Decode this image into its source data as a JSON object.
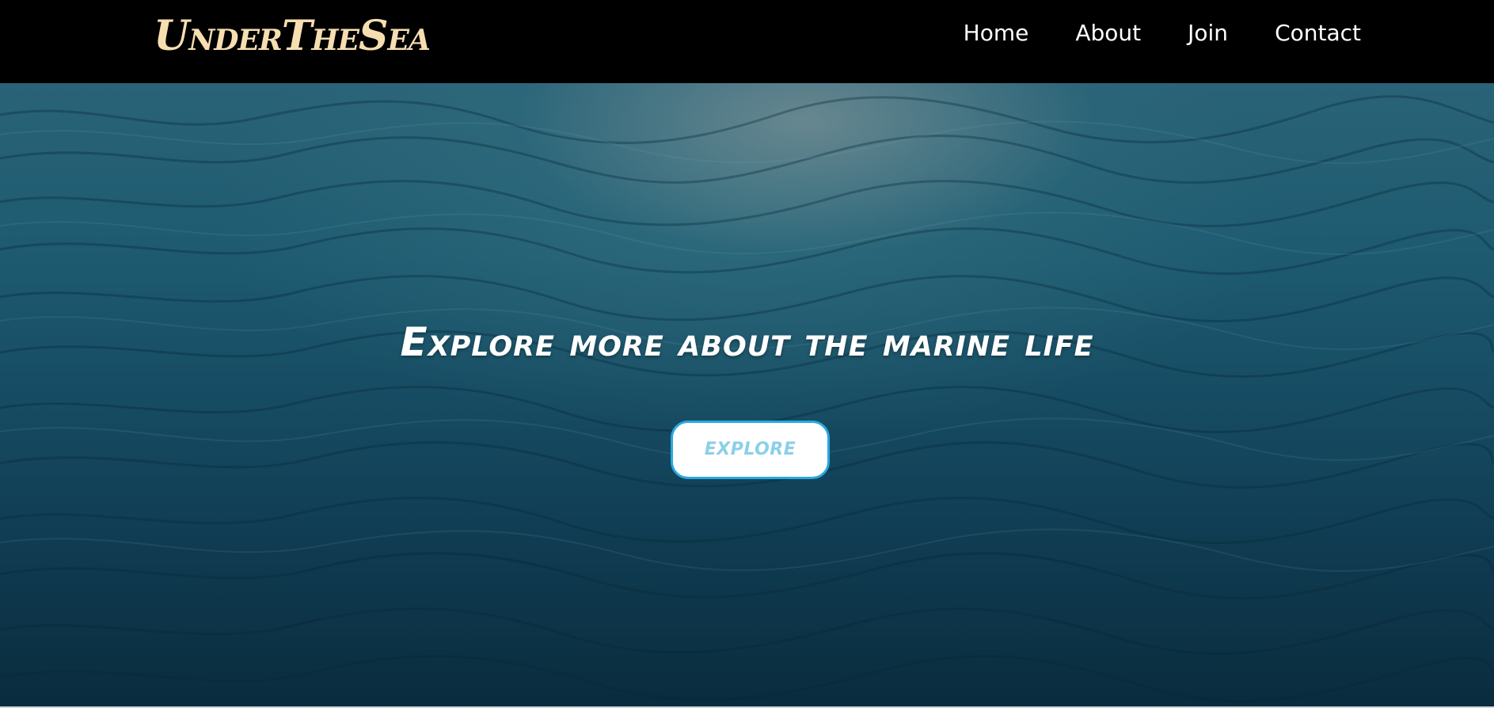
{
  "navbar": {
    "brand": "UnderTheSea",
    "links": [
      {
        "label": "Home"
      },
      {
        "label": "About"
      },
      {
        "label": "Join"
      },
      {
        "label": "Contact"
      }
    ]
  },
  "hero": {
    "title": "Explore more about the marine life",
    "button_label": "EXPLORE",
    "background_image": "underwater-ocean-surface"
  },
  "colors": {
    "navbar_bg": "#000000",
    "brand": "#f6deb0",
    "nav_text": "#ffffff",
    "hero_title": "#ffffff",
    "button_bg": "#ffffff",
    "button_border": "#29a8e0",
    "button_text": "#8ccfe8"
  }
}
